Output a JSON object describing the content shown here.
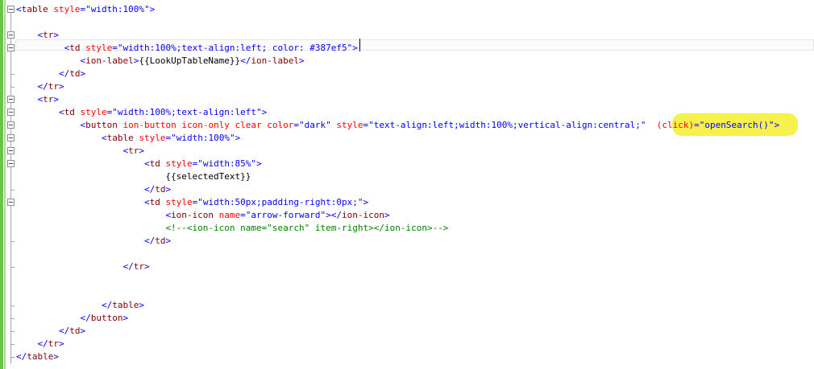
{
  "editor": {
    "lines": [
      {
        "parts": [
          {
            "c": "b",
            "t": "<"
          },
          {
            "c": "t",
            "t": "table"
          },
          {
            "c": "a",
            "t": " style"
          },
          {
            "c": "b",
            "t": "="
          },
          {
            "c": "v",
            "t": "\"width:100%\""
          },
          {
            "c": "b",
            "t": ">"
          }
        ]
      },
      {
        "parts": []
      },
      {
        "parts": [
          {
            "c": "txt",
            "t": "    "
          },
          {
            "c": "b",
            "t": "<"
          },
          {
            "c": "t",
            "t": "tr"
          },
          {
            "c": "b",
            "t": ">"
          }
        ]
      },
      {
        "parts": [
          {
            "c": "txt",
            "t": "         "
          },
          {
            "c": "b",
            "t": "<"
          },
          {
            "c": "t",
            "t": "td"
          },
          {
            "c": "a",
            "t": " style"
          },
          {
            "c": "b",
            "t": "="
          },
          {
            "c": "v",
            "t": "\"width:100%;text-align:left; color: #387ef5"
          },
          {
            "c": "v",
            "t": "\""
          },
          {
            "c": "b",
            "t": ">"
          }
        ]
      },
      {
        "parts": [
          {
            "c": "txt",
            "t": "            "
          },
          {
            "c": "b",
            "t": "<"
          },
          {
            "c": "t",
            "t": "ion-label"
          },
          {
            "c": "b",
            "t": ">"
          },
          {
            "c": "txt",
            "t": "{{LookUpTableName}}"
          },
          {
            "c": "b",
            "t": "</"
          },
          {
            "c": "t",
            "t": "ion-label"
          },
          {
            "c": "b",
            "t": ">"
          }
        ]
      },
      {
        "parts": [
          {
            "c": "txt",
            "t": "        "
          },
          {
            "c": "b",
            "t": "</"
          },
          {
            "c": "t",
            "t": "td"
          },
          {
            "c": "b",
            "t": ">"
          }
        ]
      },
      {
        "parts": [
          {
            "c": "txt",
            "t": "    "
          },
          {
            "c": "b",
            "t": "</"
          },
          {
            "c": "t",
            "t": "tr"
          },
          {
            "c": "b",
            "t": ">"
          }
        ]
      },
      {
        "parts": [
          {
            "c": "txt",
            "t": "    "
          },
          {
            "c": "b",
            "t": "<"
          },
          {
            "c": "t",
            "t": "tr"
          },
          {
            "c": "b",
            "t": ">"
          }
        ]
      },
      {
        "parts": [
          {
            "c": "txt",
            "t": "        "
          },
          {
            "c": "b",
            "t": "<"
          },
          {
            "c": "t",
            "t": "td"
          },
          {
            "c": "a",
            "t": " style"
          },
          {
            "c": "b",
            "t": "="
          },
          {
            "c": "v",
            "t": "\"width:100%;text-align:left\""
          },
          {
            "c": "b",
            "t": ">"
          }
        ]
      },
      {
        "parts": [
          {
            "c": "txt",
            "t": "            "
          },
          {
            "c": "b",
            "t": "<"
          },
          {
            "c": "t",
            "t": "button"
          },
          {
            "c": "a",
            "t": " ion-button icon-only clear color"
          },
          {
            "c": "b",
            "t": "="
          },
          {
            "c": "v",
            "t": "\"dark\""
          },
          {
            "c": "a",
            "t": " style"
          },
          {
            "c": "b",
            "t": "="
          },
          {
            "c": "v",
            "t": "\"text-align:left;width:100%;vertical-align:central;\""
          },
          {
            "c": "a",
            "t": "  (click)"
          },
          {
            "c": "b",
            "t": "="
          },
          {
            "c": "v",
            "t": "\"openSearch()\""
          },
          {
            "c": "b",
            "t": ">"
          }
        ]
      },
      {
        "parts": [
          {
            "c": "txt",
            "t": "                "
          },
          {
            "c": "b",
            "t": "<"
          },
          {
            "c": "t",
            "t": "table"
          },
          {
            "c": "a",
            "t": " style"
          },
          {
            "c": "b",
            "t": "="
          },
          {
            "c": "v",
            "t": "\"width:100%\""
          },
          {
            "c": "b",
            "t": ">"
          }
        ]
      },
      {
        "parts": [
          {
            "c": "txt",
            "t": "                    "
          },
          {
            "c": "b",
            "t": "<"
          },
          {
            "c": "t",
            "t": "tr"
          },
          {
            "c": "b",
            "t": ">"
          }
        ]
      },
      {
        "parts": [
          {
            "c": "txt",
            "t": "                        "
          },
          {
            "c": "b",
            "t": "<"
          },
          {
            "c": "t",
            "t": "td"
          },
          {
            "c": "a",
            "t": " style"
          },
          {
            "c": "b",
            "t": "="
          },
          {
            "c": "v",
            "t": "\"width:85%\""
          },
          {
            "c": "b",
            "t": ">"
          }
        ]
      },
      {
        "parts": [
          {
            "c": "txt",
            "t": "                            {{selectedText}}"
          }
        ]
      },
      {
        "parts": [
          {
            "c": "txt",
            "t": "                        "
          },
          {
            "c": "b",
            "t": "</"
          },
          {
            "c": "t",
            "t": "td"
          },
          {
            "c": "b",
            "t": ">"
          }
        ]
      },
      {
        "parts": [
          {
            "c": "txt",
            "t": "                        "
          },
          {
            "c": "b",
            "t": "<"
          },
          {
            "c": "t",
            "t": "td"
          },
          {
            "c": "a",
            "t": " style"
          },
          {
            "c": "b",
            "t": "="
          },
          {
            "c": "v",
            "t": "\"width:50px;padding-right:0px;\""
          },
          {
            "c": "b",
            "t": ">"
          }
        ]
      },
      {
        "parts": [
          {
            "c": "txt",
            "t": "                            "
          },
          {
            "c": "b",
            "t": "<"
          },
          {
            "c": "t",
            "t": "ion-icon"
          },
          {
            "c": "a",
            "t": " name"
          },
          {
            "c": "b",
            "t": "="
          },
          {
            "c": "v",
            "t": "\"arrow-forward\""
          },
          {
            "c": "b",
            "t": "></"
          },
          {
            "c": "t",
            "t": "ion-icon"
          },
          {
            "c": "b",
            "t": ">"
          }
        ]
      },
      {
        "parts": [
          {
            "c": "txt",
            "t": "                            "
          },
          {
            "c": "g",
            "t": "<!--<ion-icon name=\"search\" item-right></ion-icon>-->"
          }
        ]
      },
      {
        "parts": [
          {
            "c": "txt",
            "t": "                        "
          },
          {
            "c": "b",
            "t": "</"
          },
          {
            "c": "t",
            "t": "td"
          },
          {
            "c": "b",
            "t": ">"
          }
        ]
      },
      {
        "parts": []
      },
      {
        "parts": [
          {
            "c": "txt",
            "t": "                    "
          },
          {
            "c": "b",
            "t": "</"
          },
          {
            "c": "t",
            "t": "tr"
          },
          {
            "c": "b",
            "t": ">"
          }
        ]
      },
      {
        "parts": []
      },
      {
        "parts": []
      },
      {
        "parts": [
          {
            "c": "txt",
            "t": "                "
          },
          {
            "c": "b",
            "t": "</"
          },
          {
            "c": "t",
            "t": "table"
          },
          {
            "c": "b",
            "t": ">"
          }
        ]
      },
      {
        "parts": [
          {
            "c": "txt",
            "t": "            "
          },
          {
            "c": "b",
            "t": "</"
          },
          {
            "c": "t",
            "t": "button"
          },
          {
            "c": "b",
            "t": ">"
          }
        ]
      },
      {
        "parts": [
          {
            "c": "txt",
            "t": "        "
          },
          {
            "c": "b",
            "t": "</"
          },
          {
            "c": "t",
            "t": "td"
          },
          {
            "c": "b",
            "t": ">"
          }
        ]
      },
      {
        "parts": [
          {
            "c": "txt",
            "t": "    "
          },
          {
            "c": "b",
            "t": "</"
          },
          {
            "c": "t",
            "t": "tr"
          },
          {
            "c": "b",
            "t": ">"
          }
        ]
      },
      {
        "parts": [
          {
            "c": "b",
            "t": "</"
          },
          {
            "c": "t",
            "t": "table"
          },
          {
            "c": "b",
            "t": ">"
          }
        ]
      }
    ]
  }
}
